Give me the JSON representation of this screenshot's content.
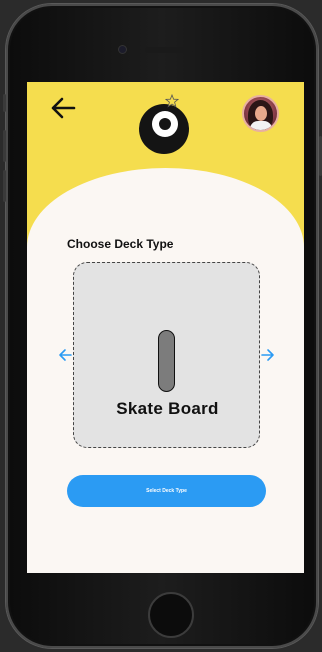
{
  "colors": {
    "header_bg": "#f5dd4e",
    "content_bg": "#fbf7f3",
    "card_bg": "#e3e3e3",
    "accent": "#2b9bf3",
    "text": "#111111"
  },
  "header": {
    "back_icon": "arrow-left-icon",
    "logo_icon": "eye-logo-icon",
    "avatar_icon": "user-avatar"
  },
  "deck_selector": {
    "title": "Choose Deck Type",
    "current_deck": "Skate Board",
    "prev_icon": "arrow-left-icon",
    "next_icon": "arrow-right-icon"
  },
  "actions": {
    "select_label": "Select Deck Type"
  }
}
